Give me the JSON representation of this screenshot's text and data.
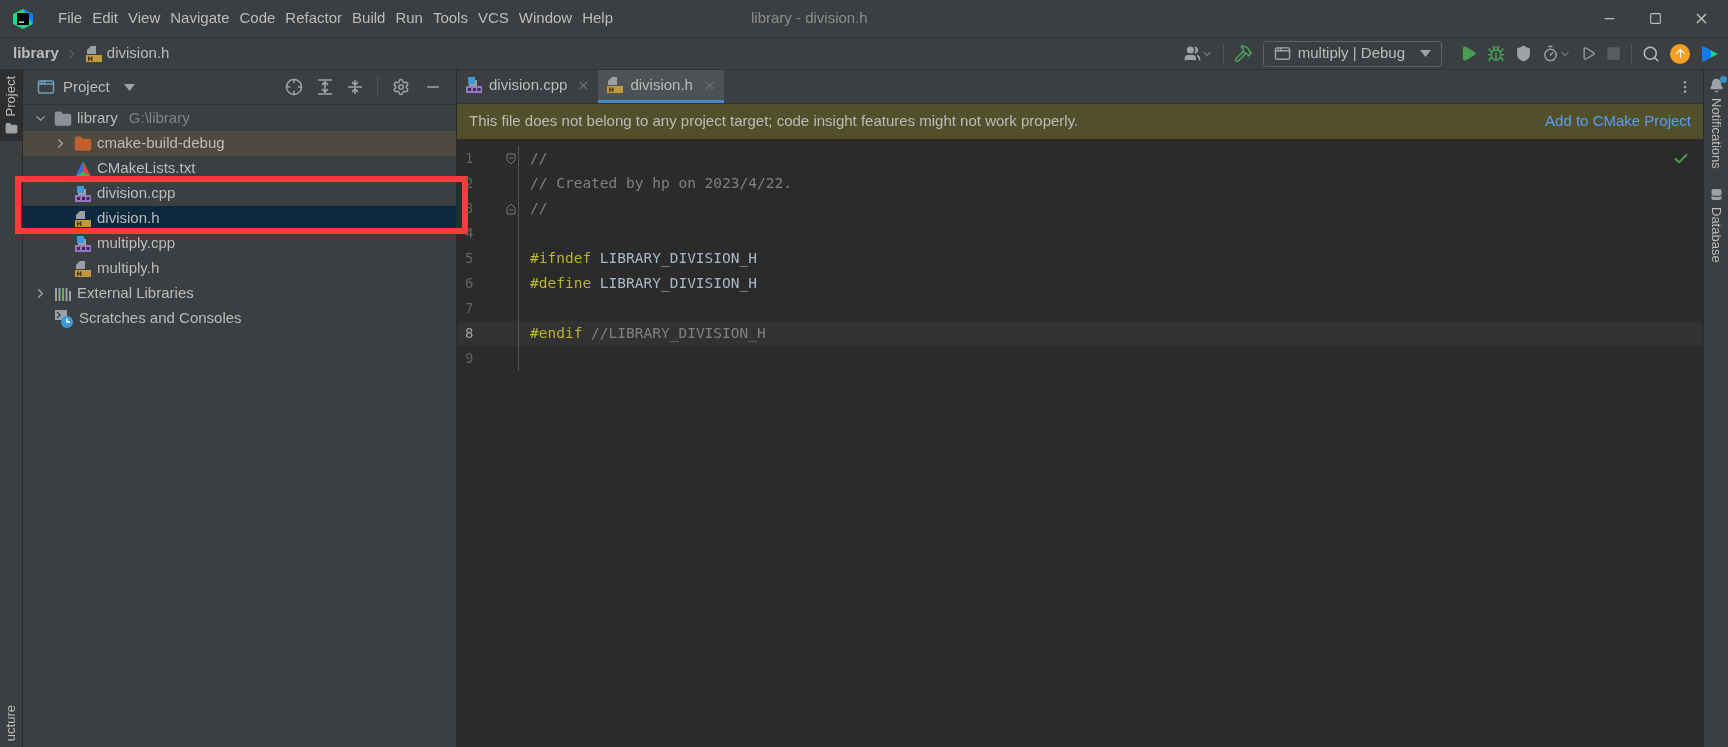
{
  "window": {
    "title": "library - division.h"
  },
  "menu": [
    {
      "label": "File"
    },
    {
      "label": "Edit"
    },
    {
      "label": "View"
    },
    {
      "label": "Navigate"
    },
    {
      "label": "Code"
    },
    {
      "label": "Refactor"
    },
    {
      "label": "Build"
    },
    {
      "label": "Run"
    },
    {
      "label": "Tools"
    },
    {
      "label": "VCS"
    },
    {
      "label": "Window"
    },
    {
      "label": "Help"
    }
  ],
  "breadcrumb": [
    {
      "label": "library",
      "kind": "project"
    },
    {
      "label": "division.h",
      "kind": "header"
    }
  ],
  "toolbar": {
    "run_configuration": "multiply | Debug",
    "stop_disabled": true,
    "update_available": true
  },
  "left_strip": [
    {
      "label": "Project",
      "selected": true
    },
    {
      "label": "ucture",
      "selected": false
    }
  ],
  "right_strip": [
    {
      "label": "Notifications",
      "kind": "notifications",
      "unread": true
    },
    {
      "label": "Database",
      "kind": "database",
      "unread": false
    }
  ],
  "project_panel": {
    "title": "Project",
    "tree": [
      {
        "label": "library",
        "path": "G:\\library",
        "kind": "folder",
        "expanded": true,
        "selected": false,
        "children": [
          {
            "label": "cmake-build-debug",
            "kind": "excluded-folder",
            "expanded": false,
            "selected": false
          },
          {
            "label": "CMakeLists.txt",
            "kind": "cmake",
            "selected": false
          },
          {
            "label": "division.cpp",
            "kind": "cpp",
            "selected": false
          },
          {
            "label": "division.h",
            "kind": "header",
            "selected": true
          },
          {
            "label": "multiply.cpp",
            "kind": "cpp",
            "selected": false
          },
          {
            "label": "multiply.h",
            "kind": "header",
            "selected": false
          }
        ]
      },
      {
        "label": "External Libraries",
        "kind": "libraries",
        "expanded": false,
        "selected": false
      },
      {
        "label": "Scratches and Consoles",
        "kind": "scratches",
        "selected": false
      }
    ]
  },
  "annotations": [
    {
      "kind": "frame"
    }
  ],
  "editor": {
    "tabs": [
      {
        "label": "division.cpp",
        "kind": "cpp",
        "selected": false
      },
      {
        "label": "division.h",
        "kind": "header",
        "selected": true
      }
    ],
    "banner": {
      "message": "This file does not belong to any project target; code insight features might not work properly.",
      "action": "Add to CMake Project"
    },
    "lines": [
      {
        "number": "1",
        "current": false,
        "fold_start": true,
        "fold_end": false,
        "tokens": [
          {
            "kind": "comment",
            "text": "//"
          }
        ]
      },
      {
        "number": "2",
        "current": false,
        "fold_start": false,
        "fold_end": false,
        "tokens": [
          {
            "kind": "comment",
            "text": "// Created by hp on 2023/4/22."
          }
        ]
      },
      {
        "number": "3",
        "current": false,
        "fold_start": false,
        "fold_end": true,
        "tokens": [
          {
            "kind": "comment",
            "text": "//"
          }
        ]
      },
      {
        "number": "4",
        "current": false,
        "fold_start": false,
        "fold_end": false
      },
      {
        "number": "5",
        "current": false,
        "fold_start": false,
        "fold_end": false,
        "tokens": [
          {
            "kind": "directive",
            "text": "#ifndef"
          },
          {
            "kind": "plain",
            "text": " LIBRARY_DIVISION_H"
          }
        ]
      },
      {
        "number": "6",
        "current": false,
        "fold_start": false,
        "fold_end": false,
        "tokens": [
          {
            "kind": "directive",
            "text": "#define"
          },
          {
            "kind": "plain",
            "text": " LIBRARY_DIVISION_H"
          }
        ]
      },
      {
        "number": "7",
        "current": false,
        "fold_start": false,
        "fold_end": false
      },
      {
        "number": "8",
        "current": true,
        "fold_start": false,
        "fold_end": false,
        "tokens": [
          {
            "kind": "directive",
            "text": "#endif"
          },
          {
            "kind": "comment",
            "text": " //LIBRARY_DIVISION_H"
          }
        ]
      },
      {
        "number": "9",
        "current": false,
        "fold_start": false,
        "fold_end": false
      }
    ]
  }
}
